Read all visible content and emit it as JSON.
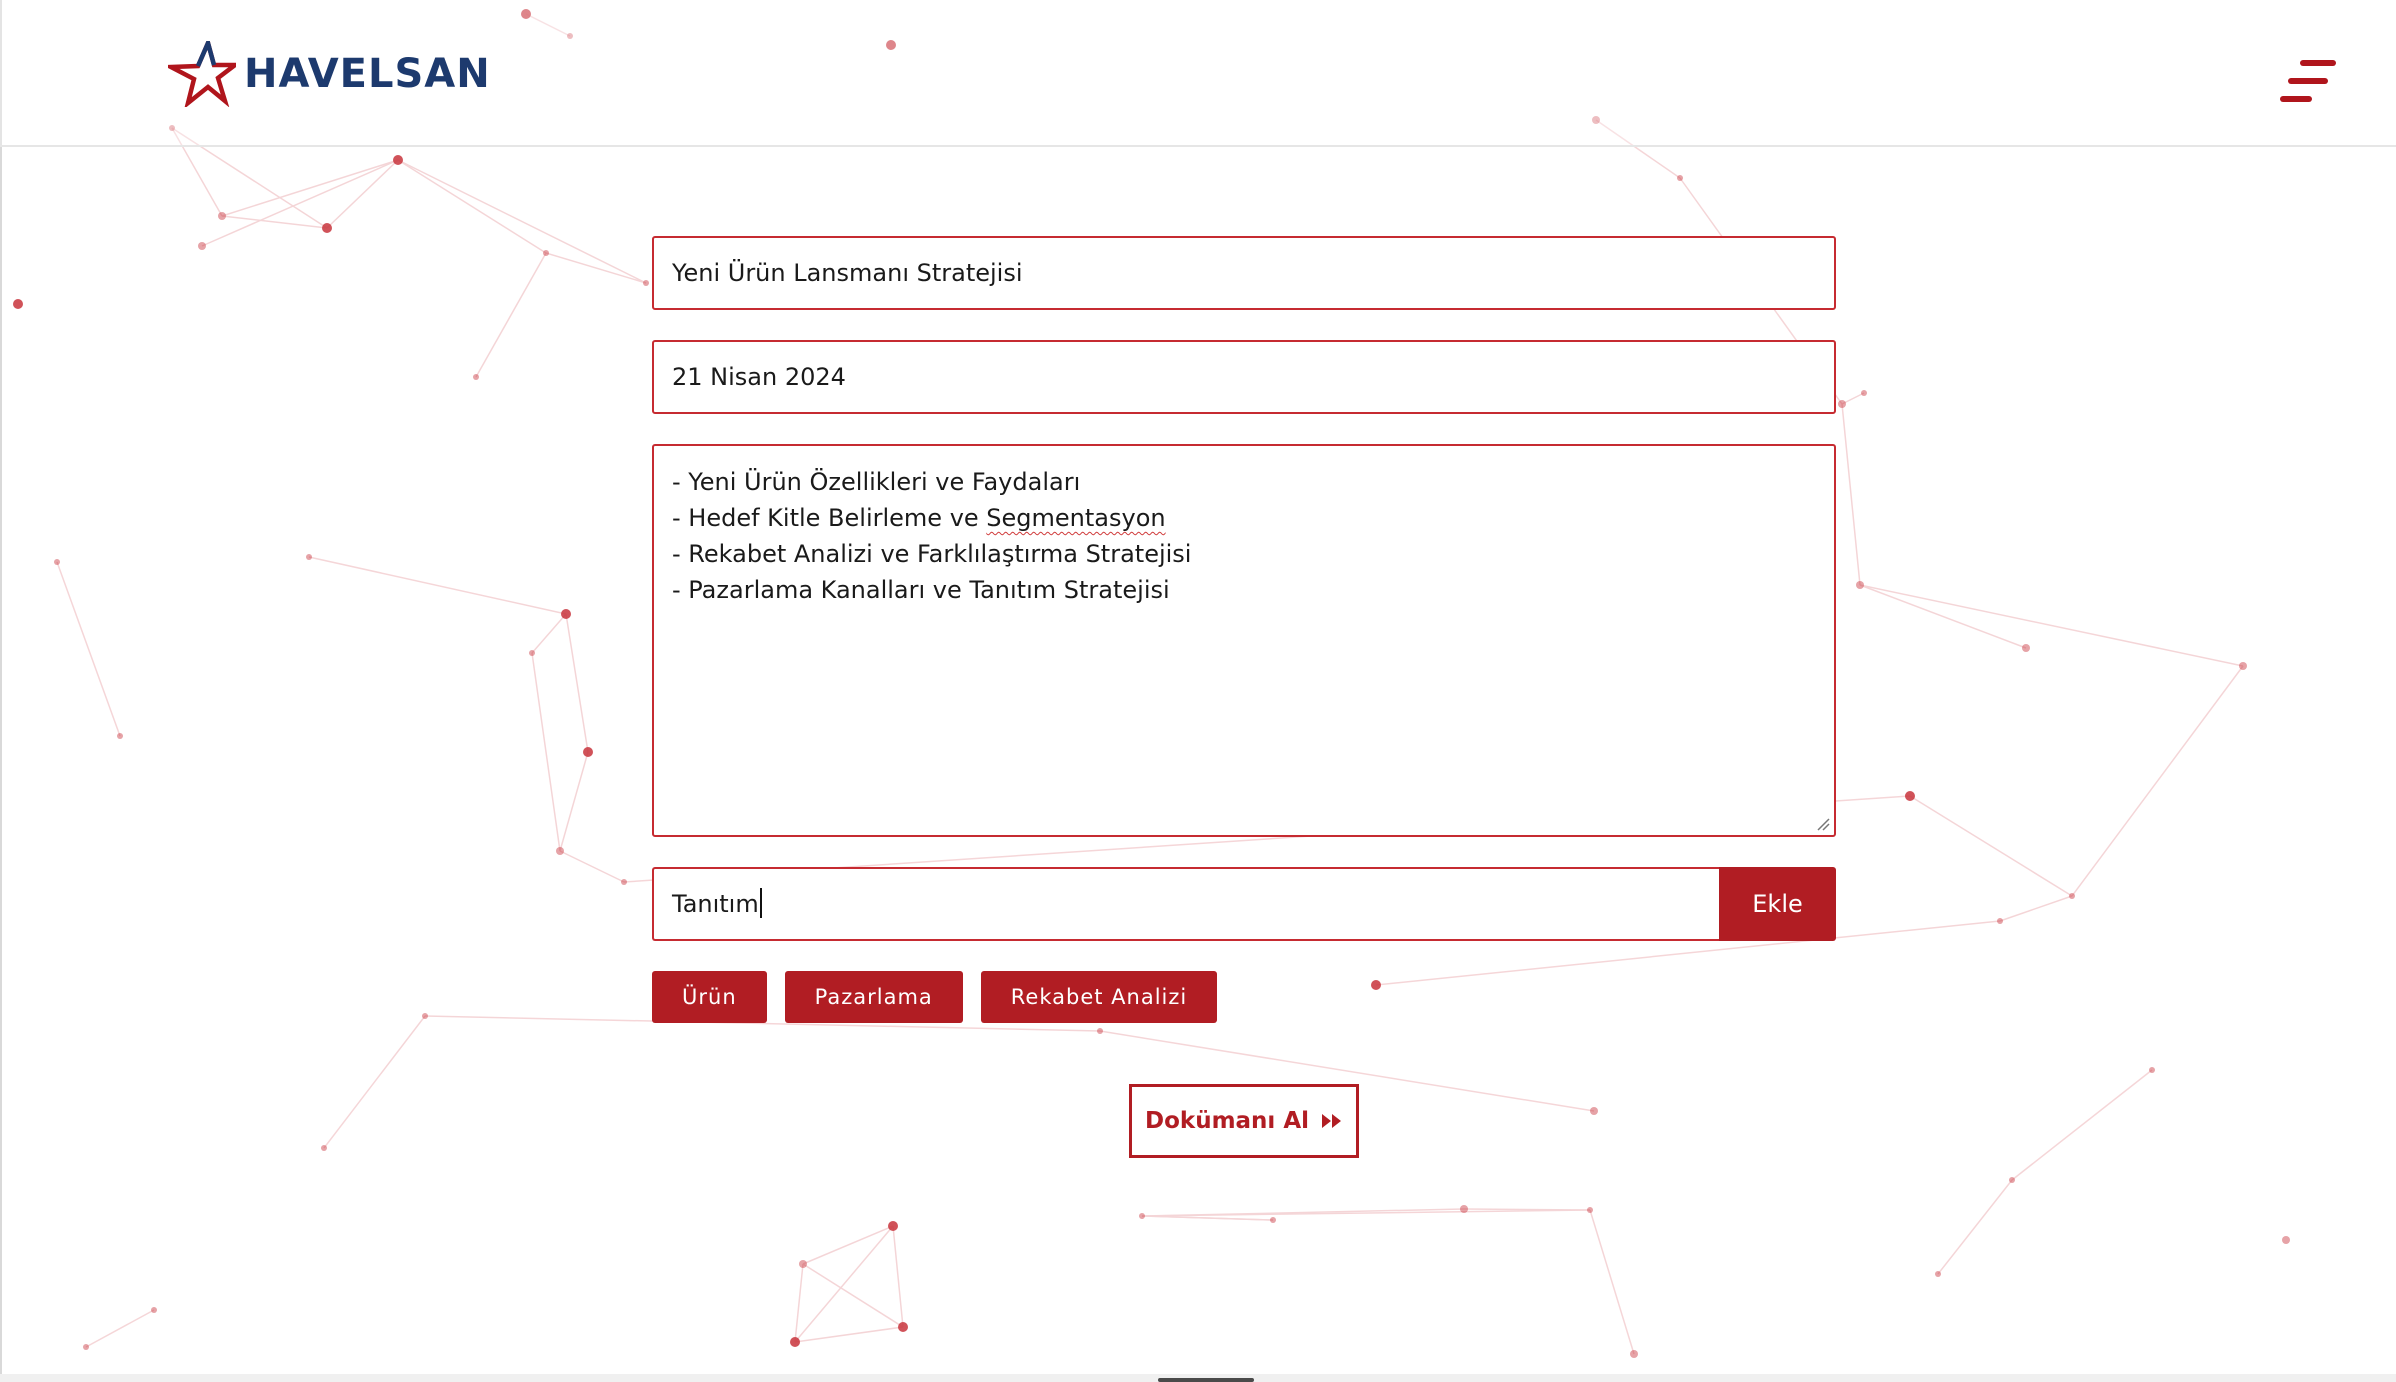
{
  "header": {
    "brand": "HAVELSAN",
    "logo_icon": "havelsan-star-logo",
    "menu_icon": "hamburger-menu-icon"
  },
  "form": {
    "title_value": "Yeni Ürün Lansmanı Stratejisi",
    "date_value": "21 Nisan 2024",
    "agenda_lines": [
      "- Yeni Ürün Özellikleri ve Faydaları",
      "- Hedef Kitle Belirleme ve ",
      "- Rekabet Analizi ve Farklılaştırma Stratejisi",
      "- Pazarlama Kanalları ve Tanıtım Stratejisi"
    ],
    "agenda_line_2_tail": "Segmentasyon",
    "tag_input_value": "Tanıtım",
    "add_button_label": "Ekle"
  },
  "tags": [
    "Ürün",
    "Pazarlama",
    "Rekabet Analizi"
  ],
  "actions": {
    "get_document_label": "Dokümanı Al",
    "get_document_icon": "fast-forward-icon"
  },
  "colors": {
    "brand_red": "#b11d23",
    "brand_navy": "#1d3a6e",
    "network_line": "#e8a4a8",
    "network_dot": "#c8343c"
  }
}
